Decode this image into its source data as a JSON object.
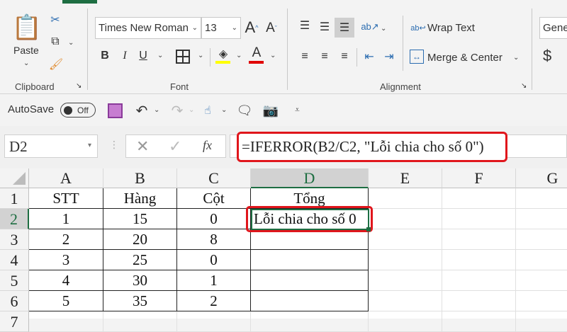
{
  "ribbon": {
    "clipboard": {
      "label": "Clipboard",
      "paste": "Paste"
    },
    "font": {
      "label": "Font",
      "name": "Times New Roman",
      "size": "13",
      "bold": "B",
      "italic": "I",
      "underline": "U",
      "fill_color": "#ffff00",
      "font_color": "#e00000"
    },
    "alignment": {
      "label": "Alignment",
      "wrap_text": "Wrap Text",
      "merge_center": "Merge & Center"
    },
    "number": {
      "format": "Gene",
      "currency": "$"
    }
  },
  "qat": {
    "autosave": "AutoSave",
    "toggle": "Off"
  },
  "formula_bar": {
    "name_box": "D2",
    "fx": "fx",
    "formula": "=IFERROR(B2/C2, \"Lỗi chia cho số 0\")"
  },
  "sheet": {
    "columns": [
      "A",
      "B",
      "C",
      "D",
      "E",
      "F",
      "G"
    ],
    "rows": [
      "1",
      "2",
      "3",
      "4",
      "5",
      "6",
      "7"
    ],
    "header": [
      "STT",
      "Hàng",
      "Cột",
      "Tổng"
    ],
    "data": [
      [
        "1",
        "15",
        "0",
        "Lỗi chia cho số 0"
      ],
      [
        "2",
        "20",
        "8",
        ""
      ],
      [
        "3",
        "25",
        "0",
        ""
      ],
      [
        "4",
        "30",
        "1",
        ""
      ],
      [
        "5",
        "35",
        "2",
        ""
      ]
    ]
  },
  "colors": {
    "accent": "#1e6e42",
    "highlight": "#e0161c"
  }
}
